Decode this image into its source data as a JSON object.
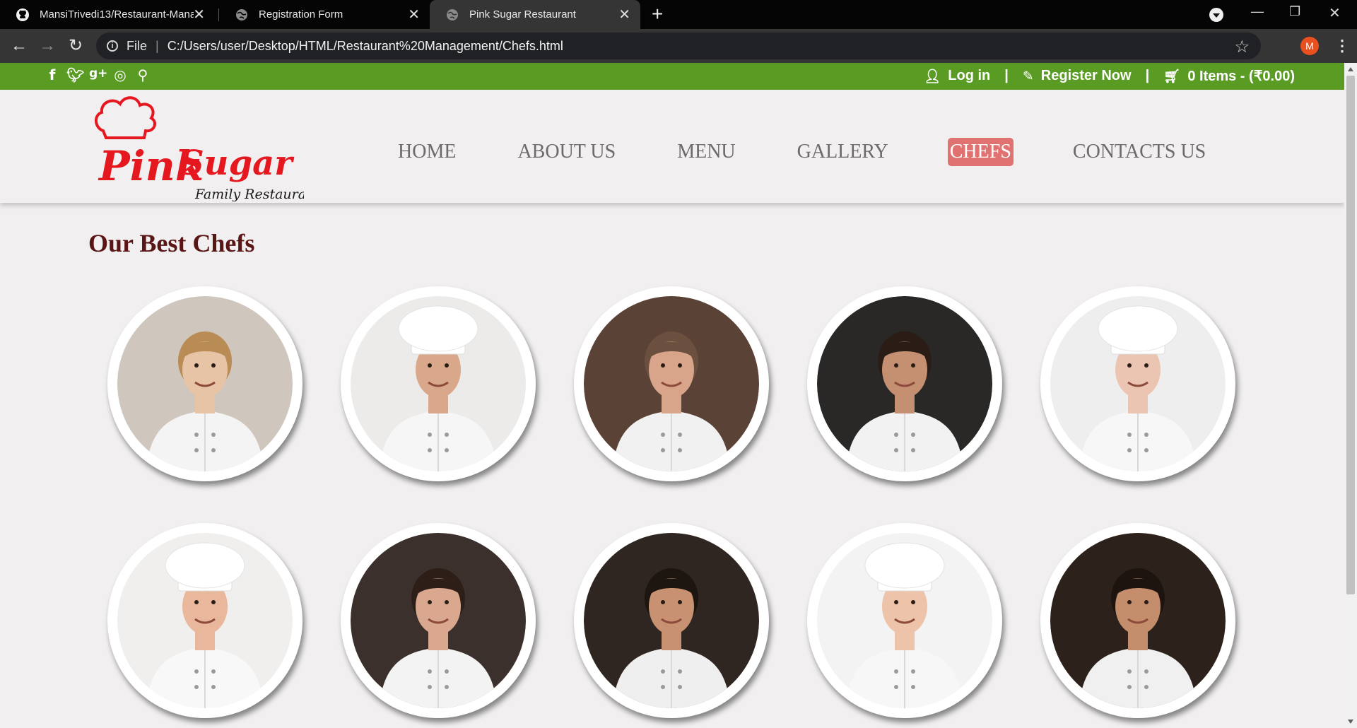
{
  "browser": {
    "tabs": [
      {
        "title": "MansiTrivedi13/Restaurant-Mana",
        "icon": "github-icon",
        "active": false
      },
      {
        "title": "Registration Form",
        "icon": "globe-icon",
        "active": false
      },
      {
        "title": "Pink Sugar Restaurant",
        "icon": "globe-icon",
        "active": true
      }
    ],
    "address": {
      "scheme_label": "File",
      "url": "C:/Users/user/Desktop/HTML/Restaurant%20Management/Chefs.html"
    },
    "profile_initial": "M"
  },
  "topbar": {
    "social_icons": [
      "facebook-icon",
      "twitter-icon",
      "google-plus-icon",
      "instagram-icon",
      "search-icon"
    ],
    "login_label": "Log in",
    "register_label": "Register Now",
    "cart_label": "0 Items - (₹0.00)",
    "separator": "|"
  },
  "logo": {
    "brand_first": "Pink",
    "brand_second": "Sugar",
    "tagline": "Family Restaurant"
  },
  "nav": {
    "items": [
      "HOME",
      "ABOUT US",
      "MENU",
      "GALLERY",
      "CHEFS",
      "CONTACTS US"
    ],
    "active": "CHEFS"
  },
  "page": {
    "heading": "Our Best Chefs"
  },
  "chefs": [
    {
      "image": "chef-photo-1",
      "bg": "#cfc7bd",
      "skin": "#e7c4a5",
      "hair": "#b98c55",
      "hat": false,
      "coat": "#f4f4f4"
    },
    {
      "image": "chef-photo-2",
      "bg": "#ecebea",
      "skin": "#d9a88a",
      "hair": "#3b2a20",
      "hat": true,
      "coat": "#f6f6f6"
    },
    {
      "image": "chef-photo-3",
      "bg": "#5b4236",
      "skin": "#d8a58a",
      "hair": "#6b5040",
      "hat": false,
      "coat": "#f1f1f1"
    },
    {
      "image": "chef-photo-4",
      "bg": "#2a2827",
      "skin": "#c58f72",
      "hair": "#2a1d16",
      "hat": false,
      "coat": "#f2f2f2"
    },
    {
      "image": "chef-photo-5",
      "bg": "#efeeee",
      "skin": "#ecc5b2",
      "hair": "#6b4a35",
      "hat": true,
      "coat": "#f7f7f7"
    },
    {
      "image": "chef-photo-6",
      "bg": "#f0efee",
      "skin": "#e8b79c",
      "hair": "#7b4a2e",
      "hat": true,
      "coat": "#f8f8f8"
    },
    {
      "image": "chef-photo-7",
      "bg": "#3b302b",
      "skin": "#d9a88f",
      "hair": "#2d1f18",
      "hat": false,
      "coat": "#f3f3f3"
    },
    {
      "image": "chef-photo-8",
      "bg": "#2f2521",
      "skin": "#c89272",
      "hair": "#1d1510",
      "hat": false,
      "coat": "#efefef"
    },
    {
      "image": "chef-photo-9",
      "bg": "#f3f3f3",
      "skin": "#edc4aa",
      "hair": "#d6a55e",
      "hat": true,
      "coat": "#f7f7f7"
    },
    {
      "image": "chef-photo-10",
      "bg": "#2d211c",
      "skin": "#c48d6c",
      "hair": "#1d140f",
      "hat": false,
      "coat": "#f0f0f0"
    }
  ],
  "colors": {
    "topbar_green": "#5a9b24",
    "nav_active_bg": "#e07272",
    "heading_color": "#5a1515",
    "logo_red": "#e5171f"
  }
}
